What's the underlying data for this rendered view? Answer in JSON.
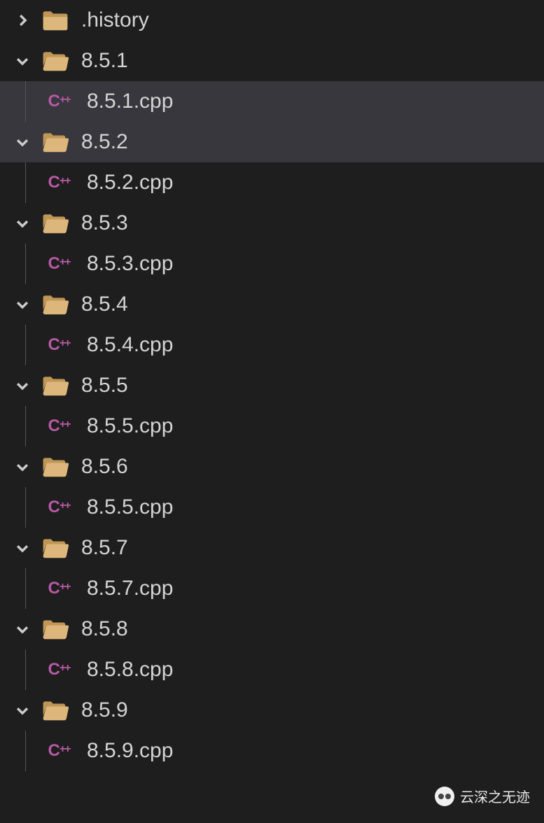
{
  "tree": [
    {
      "type": "folder",
      "expanded": false,
      "name": ".history",
      "iconState": "closed",
      "selected": false
    },
    {
      "type": "folder",
      "expanded": true,
      "name": "8.5.1",
      "iconState": "open",
      "selected": false
    },
    {
      "type": "file",
      "name": "8.5.1.cpp",
      "fileType": "cpp",
      "selected": true
    },
    {
      "type": "folder",
      "expanded": true,
      "name": "8.5.2",
      "iconState": "open",
      "selected": false,
      "hover": true
    },
    {
      "type": "file",
      "name": "8.5.2.cpp",
      "fileType": "cpp",
      "selected": false
    },
    {
      "type": "folder",
      "expanded": true,
      "name": "8.5.3",
      "iconState": "open",
      "selected": false
    },
    {
      "type": "file",
      "name": "8.5.3.cpp",
      "fileType": "cpp",
      "selected": false
    },
    {
      "type": "folder",
      "expanded": true,
      "name": "8.5.4",
      "iconState": "open",
      "selected": false
    },
    {
      "type": "file",
      "name": "8.5.4.cpp",
      "fileType": "cpp",
      "selected": false
    },
    {
      "type": "folder",
      "expanded": true,
      "name": "8.5.5",
      "iconState": "open",
      "selected": false
    },
    {
      "type": "file",
      "name": "8.5.5.cpp",
      "fileType": "cpp",
      "selected": false
    },
    {
      "type": "folder",
      "expanded": true,
      "name": "8.5.6",
      "iconState": "open",
      "selected": false
    },
    {
      "type": "file",
      "name": "8.5.5.cpp",
      "fileType": "cpp",
      "selected": false
    },
    {
      "type": "folder",
      "expanded": true,
      "name": "8.5.7",
      "iconState": "open",
      "selected": false
    },
    {
      "type": "file",
      "name": "8.5.7.cpp",
      "fileType": "cpp",
      "selected": false
    },
    {
      "type": "folder",
      "expanded": true,
      "name": "8.5.8",
      "iconState": "open",
      "selected": false
    },
    {
      "type": "file",
      "name": "8.5.8.cpp",
      "fileType": "cpp",
      "selected": false
    },
    {
      "type": "folder",
      "expanded": true,
      "name": "8.5.9",
      "iconState": "open",
      "selected": false
    },
    {
      "type": "file",
      "name": "8.5.9.cpp",
      "fileType": "cpp",
      "selected": false
    }
  ],
  "icons": {
    "cpp_label_c": "C",
    "cpp_label_plus": "++"
  },
  "watermark": {
    "text": "云深之无迹"
  }
}
